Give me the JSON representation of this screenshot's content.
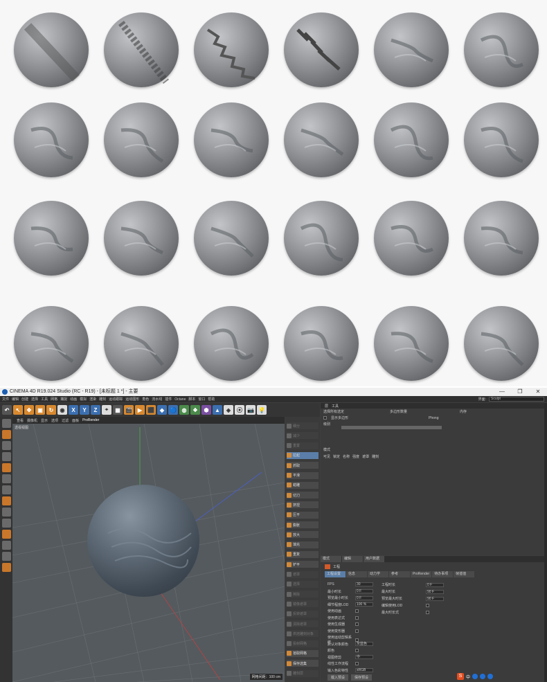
{
  "window": {
    "title": "CINEMA 4D R19.024 Studio (RC - R19) - [未标题 1 *] - 主要",
    "controls": [
      "—",
      "❐",
      "✕"
    ]
  },
  "menu": {
    "items": [
      "文件",
      "编辑",
      "创建",
      "选择",
      "工具",
      "网格",
      "捕捉",
      "动画",
      "模拟",
      "渲染",
      "雕刻",
      "运动跟踪",
      "运动图形",
      "角色",
      "流水线",
      "插件",
      "Octane",
      "脚本",
      "窗口",
      "帮助"
    ],
    "layout_label": "界面:",
    "layout_value": "Sculpt"
  },
  "toolbar": {
    "buttons": [
      "↶",
      "↖",
      "✥",
      "▣",
      "↻",
      "◉",
      "X",
      "Y",
      "Z",
      "⌖",
      "▦",
      "🎬",
      "▶",
      "⬛",
      "◆",
      "🔵",
      "◍",
      "❖",
      "⬢",
      "▲",
      "◈",
      "⦿",
      "📷",
      "💡"
    ]
  },
  "viewport": {
    "menu": [
      "查看",
      "摄像机",
      "显示",
      "选项",
      "过滤",
      "面板"
    ],
    "prorender": "ProRender",
    "label": "透视视图",
    "distance": "网格间距：100 cm"
  },
  "object_panel": {
    "items": [
      {
        "label": "细分",
        "state": "dim"
      },
      {
        "label": "减少",
        "state": "dim"
      },
      {
        "label": "重置",
        "state": "dim"
      },
      {
        "label": "拉起",
        "state": "act"
      },
      {
        "label": "抓取",
        "state": "normal"
      },
      {
        "label": "平滑",
        "state": "normal"
      },
      {
        "label": "蜡雕",
        "state": "normal"
      },
      {
        "label": "切刀",
        "state": "normal"
      },
      {
        "label": "挤捏",
        "state": "normal"
      },
      {
        "label": "压平",
        "state": "normal"
      },
      {
        "label": "膨胀",
        "state": "normal"
      },
      {
        "label": "放大",
        "state": "normal"
      },
      {
        "label": "填充",
        "state": "normal"
      },
      {
        "label": "重复",
        "state": "normal"
      },
      {
        "label": "铲平",
        "state": "normal"
      },
      {
        "label": "遮罩",
        "state": "dim"
      },
      {
        "label": "选择",
        "state": "dim"
      },
      {
        "label": "擦除",
        "state": "dim"
      },
      {
        "label": "镜像遮罩",
        "state": "dim"
      },
      {
        "label": "反转遮罩",
        "state": "dim"
      },
      {
        "label": "清除遮罩",
        "state": "dim"
      },
      {
        "label": "烘焙雕刻对象",
        "state": "dim"
      },
      {
        "label": "投射网格",
        "state": "dim"
      },
      {
        "label": "拾取网格",
        "state": "normal"
      },
      {
        "label": "保存选集",
        "state": "normal"
      },
      {
        "label": "雕刻层",
        "state": "dim"
      }
    ]
  },
  "object_manager": {
    "header": [
      "层",
      "工具"
    ],
    "row1": [
      "选择所有选定",
      "多边形数量",
      "内存"
    ],
    "row2": "显示多边形",
    "phong": "Phong",
    "level_label": "级别",
    "mode_label": "模式",
    "cols": [
      "可见",
      "锁定",
      "名称",
      "强度",
      "遮罩",
      "雕刻"
    ]
  },
  "attributes": {
    "header": [
      "模式",
      "编辑",
      "用户数据"
    ],
    "title": "工程",
    "tabs": [
      "工程设置",
      "信息",
      "动力学",
      "参考",
      "ProRender",
      "待办事项",
      "帧插值"
    ],
    "fields": [
      {
        "label": "FPS",
        "value": "30"
      },
      {
        "label": "最小时长",
        "value": "0 F"
      },
      {
        "label": "预览最小时长",
        "value": "0 F"
      },
      {
        "label": "细节程度LOD",
        "value": "100 %"
      },
      {
        "label": "使用动画",
        "value": ""
      },
      {
        "label": "使用表达式",
        "value": ""
      },
      {
        "label": "使用生成器",
        "value": ""
      },
      {
        "label": "使用变形器",
        "value": ""
      },
      {
        "label": "使用运动剪辑系统",
        "value": ""
      },
      {
        "label": "默认对象颜色",
        "value": "灰蓝色"
      },
      {
        "label": "颜色",
        "value": ""
      },
      {
        "label": "视图修剪",
        "value": "中"
      },
      {
        "label": "线性工作流程",
        "value": ""
      },
      {
        "label": "输入色彩特性",
        "value": "sRGB"
      }
    ],
    "right_fields": [
      {
        "label": "工程时长",
        "value": "0 F"
      },
      {
        "label": "最大时长",
        "value": "90 F"
      },
      {
        "label": "预览最大时长",
        "value": "90 F"
      },
      {
        "label": "编辑使用LOD",
        "value": ""
      },
      {
        "label": "最大时长式",
        "value": ""
      }
    ],
    "buttons": [
      "载入预设",
      "保存预设"
    ]
  },
  "tray": {
    "ime": "S",
    "label": "中"
  }
}
